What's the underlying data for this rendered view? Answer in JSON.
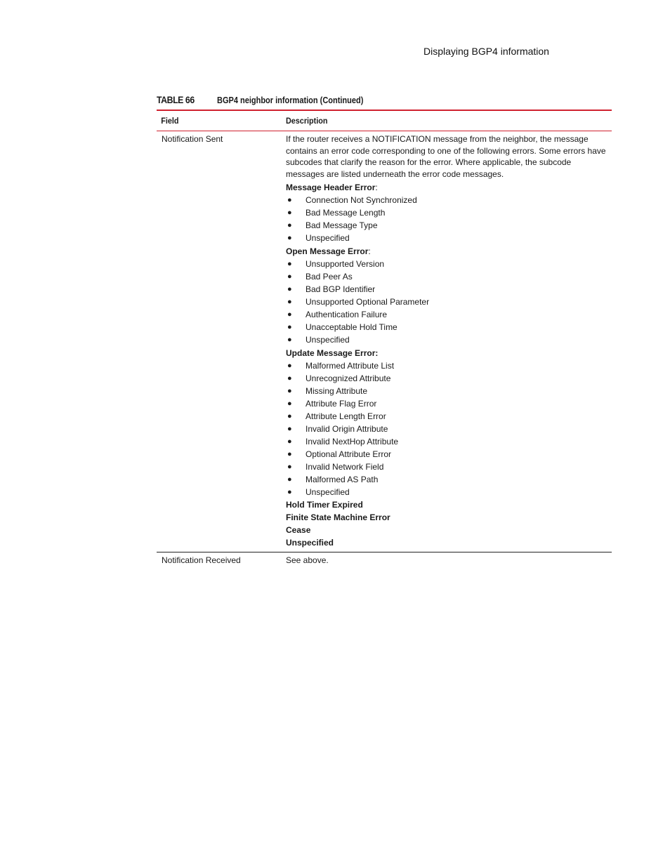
{
  "running_header": "Displaying BGP4 information",
  "table": {
    "label": "TABLE 66",
    "title": "BGP4 neighbor information (Continued)",
    "columns": [
      "Field",
      "Description"
    ],
    "rows": [
      {
        "field": "Notification Sent",
        "intro": "If the router receives a NOTIFICATION message from the neighbor, the message contains an error code corresponding to one of the following errors.  Some errors have subcodes that clarify the reason for the error. Where applicable, the subcode messages are listed underneath the error code messages.",
        "groups": [
          {
            "title": "Message Header Error",
            "suffix": ":",
            "items": [
              "Connection Not Synchronized",
              "Bad Message Length",
              "Bad Message Type",
              "Unspecified"
            ]
          },
          {
            "title": "Open Message Error",
            "suffix": ":",
            "items": [
              "Unsupported Version",
              "Bad Peer As",
              "Bad BGP Identifier",
              "Unsupported Optional Parameter",
              "Authentication Failure",
              "Unacceptable Hold Time",
              "Unspecified"
            ]
          },
          {
            "title": "Update Message Error:",
            "suffix": "",
            "items": [
              "Malformed Attribute List",
              "Unrecognized Attribute",
              "Missing Attribute",
              "Attribute Flag Error",
              "Attribute Length Error",
              "Invalid Origin Attribute",
              "Invalid NextHop Attribute",
              "Optional Attribute Error",
              "Invalid Network Field",
              "Malformed AS Path",
              "Unspecified"
            ]
          }
        ],
        "standalone": [
          "Hold Timer Expired",
          "Finite State Machine Error",
          "Cease",
          "Unspecified"
        ]
      },
      {
        "field": "Notification Received",
        "description": "See above."
      }
    ]
  },
  "bullet_glyph": "●"
}
